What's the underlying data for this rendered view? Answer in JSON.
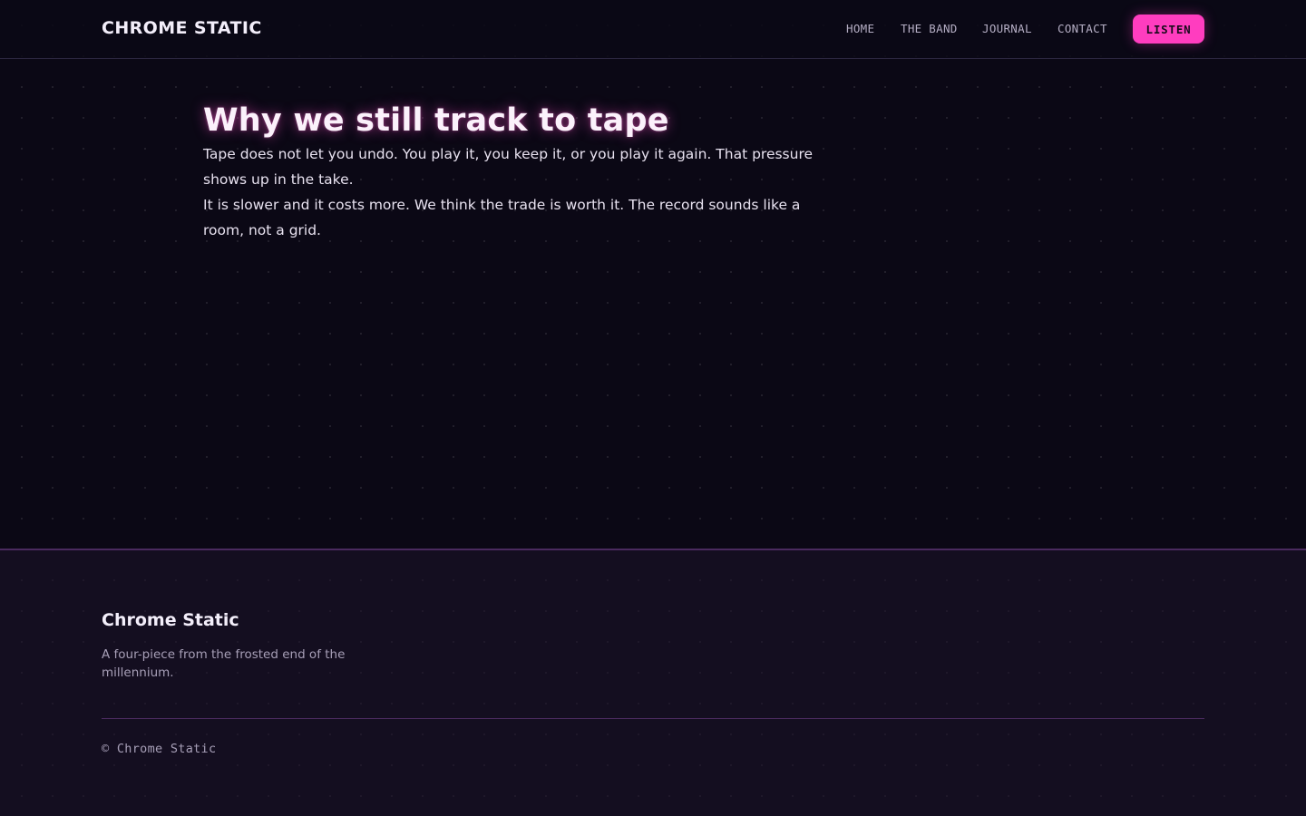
{
  "header": {
    "brand": "CHROME STATIC",
    "nav": [
      "HOME",
      "THE BAND",
      "JOURNAL",
      "CONTACT"
    ],
    "cta_label": "LISTEN"
  },
  "article": {
    "title": "Why we still track to tape",
    "paragraphs": [
      "Tape does not let you undo. You play it, you keep it, or you play it again. That pressure shows up in the take.",
      "It is slower and it costs more. We think the trade is worth it. The record sounds like a room, not a grid."
    ]
  },
  "footer": {
    "brand": "Chrome Static",
    "tagline": "A four-piece from the frosted end of the millennium.",
    "copyright": "© Chrome Static"
  },
  "colors": {
    "background": "#0b0815",
    "accent": "#ff3dbf",
    "footer_rule": "#4a2a5e"
  }
}
